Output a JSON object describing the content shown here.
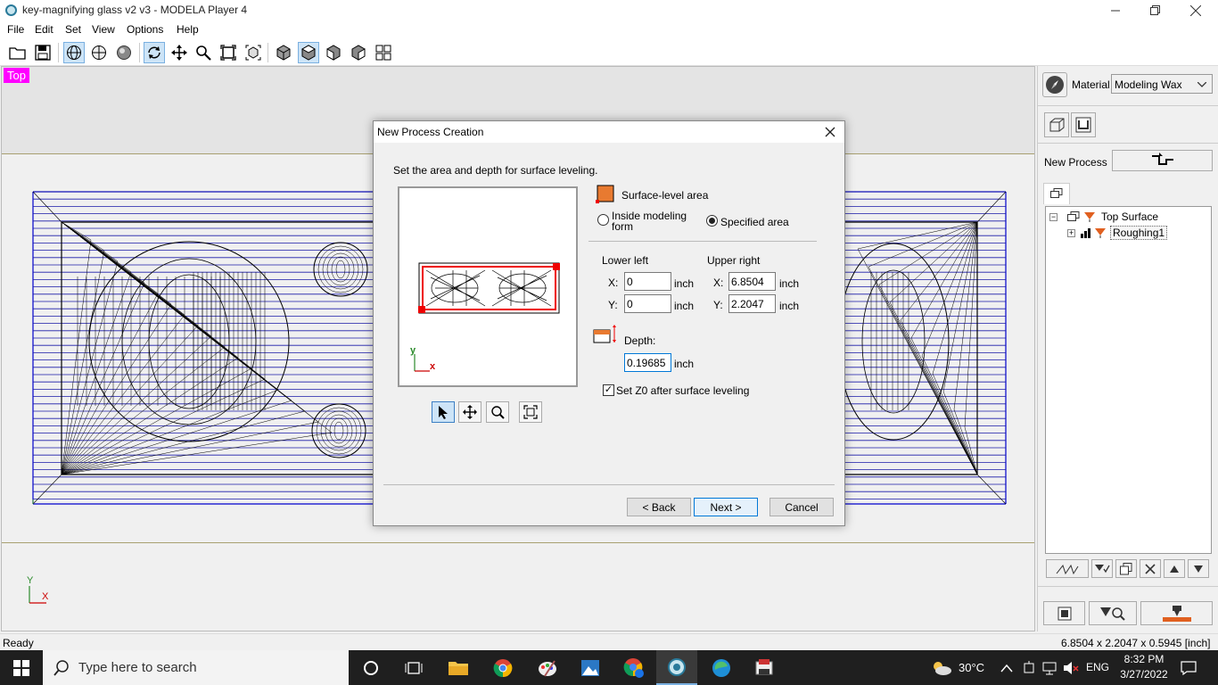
{
  "window": {
    "title": "key-magnifying glass v2 v3 - MODELA Player 4",
    "minimize_icon": "minimize-icon",
    "restore_icon": "restore-icon",
    "close_icon": "close-icon"
  },
  "menu": [
    "File",
    "Edit",
    "Set",
    "View",
    "Options",
    "Help"
  ],
  "viewport": {
    "view_label": "Top",
    "axis_y": "Y",
    "axis_x": "X",
    "view_label_color": "#ff00ff",
    "mesh_color": "#00008b"
  },
  "right_panel": {
    "material_label": "Material",
    "material_value": "Modeling Wax",
    "new_process_label": "New Process",
    "tree": [
      {
        "label": "Top Surface",
        "expanded": true
      },
      {
        "label": "Roughing1",
        "selected": true
      }
    ]
  },
  "dialog": {
    "title": "New Process Creation",
    "instruction": "Set the area and depth for surface leveling.",
    "surface_level_area": "Surface-level area",
    "option_inside": "Inside modeling form",
    "option_inside_line1": "Inside modeling",
    "option_inside_line2": "form",
    "option_specified": "Specified area",
    "selected_option": "Specified area",
    "lower_left": "Lower left",
    "upper_right": "Upper right",
    "x_label": "X:",
    "y_label": "Y:",
    "ll_x": "0",
    "ll_y": "0",
    "ur_x": "6.8504",
    "ur_y": "2.2047",
    "unit": "inch",
    "depth_label": "Depth:",
    "depth_value": "0.19685",
    "set_z0_label": "Set Z0 after surface leveling",
    "set_z0_checked": true,
    "preview_axis_y": "y",
    "preview_axis_x": "x",
    "back_label": "< Back",
    "next_label": "Next >",
    "cancel_label": "Cancel",
    "area_color": "#ff0000"
  },
  "status": {
    "left": "Ready",
    "right": "6.8504 x 2.2047 x 0.5945 [inch]"
  },
  "taskbar": {
    "search_placeholder": "Type here to search",
    "weather": "30°C",
    "language": "ENG",
    "time": "8:32 PM",
    "date": "3/27/2022"
  }
}
